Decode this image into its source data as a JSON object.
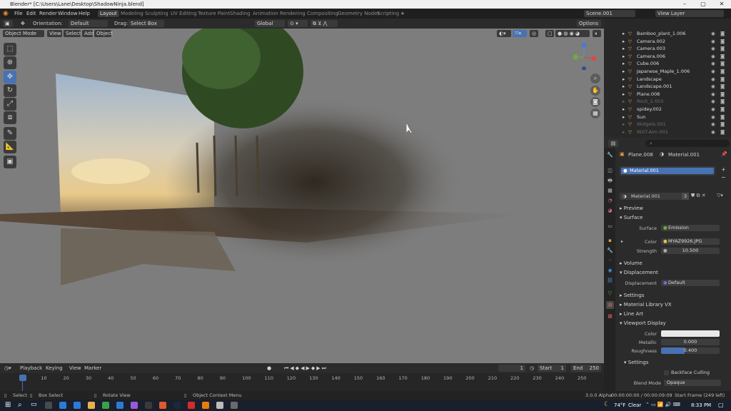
{
  "window": {
    "title": "Blender* [C:\\Users\\Lane\\Desktop\\ShadowNinja.blend]",
    "minimize": "–",
    "maximize": "▢",
    "close": "✕"
  },
  "menu": {
    "items": [
      "File",
      "Edit",
      "Render",
      "Window",
      "Help"
    ],
    "workspaces": [
      "Layout",
      "Modeling",
      "Sculpting",
      "UV Editing",
      "Texture Paint",
      "Shading",
      "Animation",
      "Rendering",
      "Compositing",
      "Geometry Nodes",
      "Scripting"
    ],
    "add_workspace": "+",
    "scene": "Scene.001",
    "view_layer": "View Layer"
  },
  "viewport_header": {
    "orientation_label": "Orientation:",
    "orientation_value": "Default",
    "drag_label": "Drag:",
    "drag_value": "Select Box",
    "transform_orientation": "Global",
    "options": "Options"
  },
  "tool_header": {
    "mode": "Object Mode",
    "menus": [
      "View",
      "Select",
      "Add",
      "Object"
    ]
  },
  "outliner": {
    "rows": [
      {
        "name": "Bamboo_plant_1.006",
        "dim": false
      },
      {
        "name": "Camera.002",
        "dim": false
      },
      {
        "name": "Camera.003",
        "dim": false
      },
      {
        "name": "Camera.006",
        "dim": false
      },
      {
        "name": "Cube.006",
        "dim": false
      },
      {
        "name": "Japanese_Maple_1.006",
        "dim": false
      },
      {
        "name": "Landscape",
        "dim": false
      },
      {
        "name": "Landscape.001",
        "dim": false
      },
      {
        "name": "Plane.008",
        "dim": false
      },
      {
        "name": "Rock_1.003",
        "dim": true
      },
      {
        "name": "spidey.002",
        "dim": false
      },
      {
        "name": "Sun",
        "dim": false
      },
      {
        "name": "Widgets.001",
        "dim": true
      },
      {
        "name": "WGT-Aim.001",
        "dim": true
      }
    ]
  },
  "properties": {
    "object": "Plane.008",
    "material_slot": "Material.001",
    "slot_item": "Material.001",
    "datablock": "Material.001",
    "user_count": "3",
    "sections": {
      "preview": "Preview",
      "surface": "Surface",
      "volume": "Volume",
      "displacement": "Displacement",
      "settings": "Settings",
      "material_library": "Material Library VX",
      "line_art": "Line Art",
      "viewport_display": "Viewport Display",
      "settings2": "Settings"
    },
    "surface_label": "Surface",
    "surface_value": "Emission",
    "color_label": "Color",
    "color_value": "MYAZ9926.JPG",
    "strength_label": "Strength",
    "strength_value": "10.500",
    "displacement_label": "Displacement",
    "displacement_value": "Default",
    "vd_color_label": "Color",
    "metallic_label": "Metallic",
    "metallic_value": "0.000",
    "roughness_label": "Roughness",
    "roughness_value": "0.400",
    "roughness_fraction": 0.4,
    "backface_label": "Backface Culling",
    "blend_mode_label": "Blend Mode",
    "blend_mode_value": "Opaque"
  },
  "timeline": {
    "menus": [
      "Playback",
      "Keying",
      "View",
      "Marker"
    ],
    "current_frame": "1",
    "start_label": "Start",
    "start": "1",
    "end_label": "End",
    "end": "250",
    "ticks": [
      "1",
      "10",
      "20",
      "30",
      "40",
      "50",
      "60",
      "70",
      "80",
      "90",
      "100",
      "110",
      "120",
      "130",
      "140",
      "150",
      "160",
      "170",
      "180",
      "190",
      "200",
      "210",
      "220",
      "230",
      "240",
      "250"
    ]
  },
  "statusbar": {
    "select": "Select",
    "box_select": "Box Select",
    "rotate_view": "Rotate View",
    "context_menu": "Object Context Menu",
    "version": "3.0.0 Alpha",
    "timecode": "00:00:00:00 / 00:00:09:09",
    "frame_info": "Start Frame (249 left)"
  },
  "taskbar": {
    "temperature": "74°F",
    "weather": "Clear",
    "time": "8:33 PM"
  },
  "colors": {
    "accent": "#4772b3",
    "viewport_bg": "#7d7d7d"
  }
}
